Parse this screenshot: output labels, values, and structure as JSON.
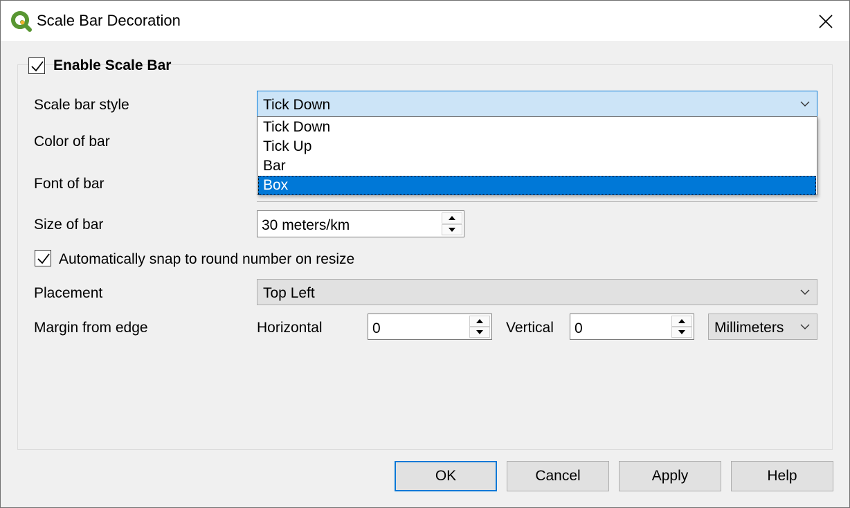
{
  "window": {
    "title": "Scale Bar Decoration"
  },
  "enable": {
    "label": "Enable Scale Bar",
    "checked": true
  },
  "style": {
    "label": "Scale bar style",
    "value": "Tick Down",
    "options": [
      "Tick Down",
      "Tick Up",
      "Bar",
      "Box"
    ],
    "highlighted": "Box"
  },
  "color": {
    "label": "Color of bar"
  },
  "font": {
    "label": "Font of bar"
  },
  "size": {
    "label": "Size of bar",
    "value": "30 meters/km"
  },
  "snap": {
    "label": "Automatically snap to round number on resize",
    "checked": true
  },
  "placement": {
    "label": "Placement",
    "value": "Top Left"
  },
  "margin": {
    "label": "Margin from edge",
    "horizontal_label": "Horizontal",
    "horizontal_value": "0",
    "vertical_label": "Vertical",
    "vertical_value": "0",
    "unit": "Millimeters"
  },
  "buttons": {
    "ok": "OK",
    "cancel": "Cancel",
    "apply": "Apply",
    "help": "Help"
  },
  "colors": {
    "accent": "#0078d7",
    "qgis_green": "#589632",
    "qgis_yellow": "#f0b32e"
  }
}
